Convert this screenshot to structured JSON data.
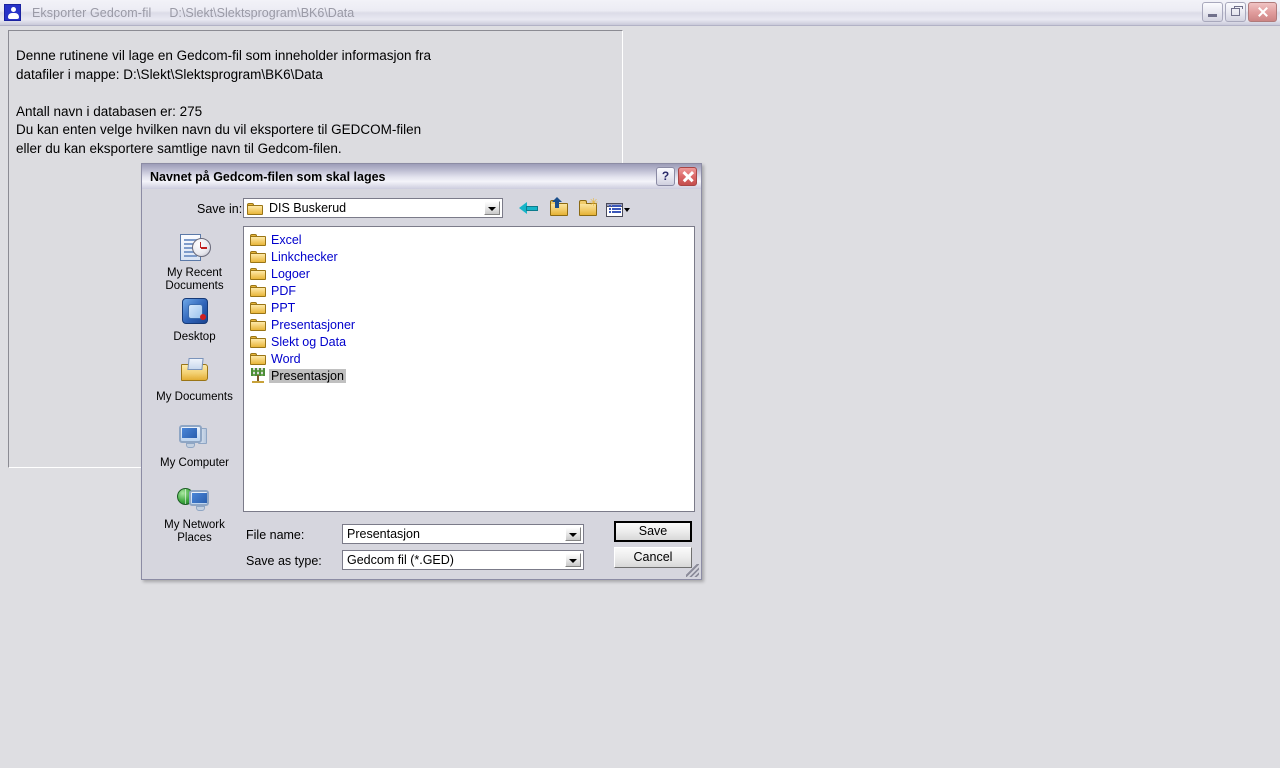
{
  "app_window": {
    "icon": "app-person-icon",
    "title": "Eksporter Gedcom-fil",
    "path": "D:\\Slekt\\Slektsprogram\\BK6\\Data",
    "buttons": {
      "minimize": "minimize-icon",
      "restore": "restore-icon",
      "close": "close-icon"
    },
    "info_text": "Denne rutinene vil lage en Gedcom-fil som inneholder informasjon fra\ndatafiler i mappe: D:\\Slekt\\Slektsprogram\\BK6\\Data\n\nAntall navn i databasen er: 275\nDu kan enten velge hvilken navn du vil eksportere til GEDCOM-filen\neller du kan eksportere samtlige navn til Gedcom-filen."
  },
  "dialog": {
    "title": "Navnet på Gedcom-filen som skal lages",
    "help_button": "?",
    "close_button": "close-icon",
    "save_in": {
      "label": "Save in:",
      "value": "DIS Buskerud"
    },
    "toolbar": [
      {
        "name": "back-icon",
        "tooltip": "Back"
      },
      {
        "name": "up-one-level-icon",
        "tooltip": "Up One Level"
      },
      {
        "name": "create-new-folder-icon",
        "tooltip": "Create New Folder"
      },
      {
        "name": "views-icon",
        "tooltip": "Views"
      }
    ],
    "places": [
      {
        "label": "My Recent\nDocuments",
        "icon": "recent-documents-icon"
      },
      {
        "label": "Desktop",
        "icon": "desktop-icon"
      },
      {
        "label": "My Documents",
        "icon": "my-documents-icon"
      },
      {
        "label": "My Computer",
        "icon": "my-computer-icon"
      },
      {
        "label": "My Network\nPlaces",
        "icon": "network-places-icon"
      }
    ],
    "files": [
      {
        "name": "Excel",
        "type": "folder",
        "selected": false
      },
      {
        "name": "Linkchecker",
        "type": "folder",
        "selected": false
      },
      {
        "name": "Logoer",
        "type": "folder",
        "selected": false
      },
      {
        "name": "PDF",
        "type": "folder",
        "selected": false
      },
      {
        "name": "PPT",
        "type": "folder",
        "selected": false
      },
      {
        "name": "Presentasjoner",
        "type": "folder",
        "selected": false
      },
      {
        "name": "Slekt og Data",
        "type": "folder",
        "selected": false
      },
      {
        "name": "Word",
        "type": "folder",
        "selected": false
      },
      {
        "name": "Presentasjon",
        "type": "file",
        "selected": true
      }
    ],
    "file_name": {
      "label": "File name:",
      "value": "Presentasjon"
    },
    "save_as_type": {
      "label": "Save as type:",
      "value": "Gedcom fil (*.GED)"
    },
    "save_label": "Save",
    "cancel_label": "Cancel"
  },
  "colors": {
    "folder_text": "#0000cc",
    "selection": "#c0c0c0",
    "dialog_face": "#d6d6de",
    "desktop": "#dedee2"
  }
}
